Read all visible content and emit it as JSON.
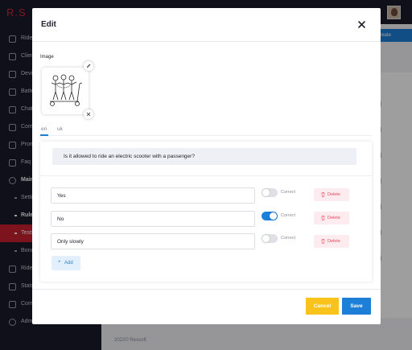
{
  "app": {
    "logo": "R.S"
  },
  "header": {
    "create_label": "Create"
  },
  "sidebar": {
    "items": [
      {
        "label": "Rides"
      },
      {
        "label": "Clients"
      },
      {
        "label": "Devices"
      },
      {
        "label": "Batteries"
      },
      {
        "label": "Chats"
      },
      {
        "label": "Comments"
      },
      {
        "label": "Promo"
      },
      {
        "label": "Faq"
      },
      {
        "label": "Main"
      },
      {
        "label": "Settings"
      },
      {
        "label": "Rules"
      },
      {
        "label": "Tests"
      },
      {
        "label": "Bonus"
      },
      {
        "label": "Rides"
      },
      {
        "label": "Stats"
      },
      {
        "label": "Comments"
      },
      {
        "label": "Admins"
      }
    ]
  },
  "footer": {
    "text": "2022© Rexsoft"
  },
  "modal": {
    "title": "Edit",
    "image_label": "Image",
    "tabs": [
      {
        "label": "en"
      },
      {
        "label": "uk"
      }
    ],
    "question": "Is it allowed to ride an electric scooter with a passenger?",
    "answers": [
      {
        "value": "Yes",
        "correct": false
      },
      {
        "value": "No",
        "correct": true
      },
      {
        "value": "Only slowly",
        "correct": false
      }
    ],
    "correct_label": "Correct",
    "delete_label": "Delete",
    "add_label": "Add",
    "cancel_label": "Cancel",
    "save_label": "Save"
  },
  "colors": {
    "primary": "#1e7fd8",
    "danger": "#e0485e",
    "warning": "#f9c31b",
    "sidebar_active": "#c8202f"
  }
}
